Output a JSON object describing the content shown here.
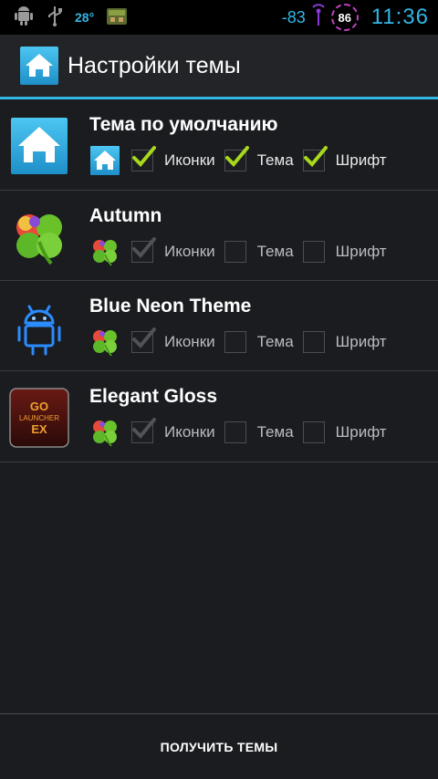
{
  "status_bar": {
    "temperature": "28°",
    "signal": "-83",
    "battery": "86",
    "time": "11:36",
    "icons": [
      "android-debug-icon",
      "usb-icon",
      "weather-icon",
      "app-notification-icon",
      "signal-icon"
    ]
  },
  "action_bar": {
    "title": "Настройки темы",
    "icon": "home-icon"
  },
  "themes": [
    {
      "name": "Тема по умолчанию",
      "icon": "default-home-icon",
      "options": [
        {
          "label": "Иконки",
          "checked": true,
          "enabled": true
        },
        {
          "label": "Тема",
          "checked": true,
          "enabled": true
        },
        {
          "label": "Шрифт",
          "checked": true,
          "enabled": true
        }
      ]
    },
    {
      "name": "Autumn",
      "icon": "clover-icon",
      "options": [
        {
          "label": "Иконки",
          "checked": true,
          "enabled": false
        },
        {
          "label": "Тема",
          "checked": false,
          "enabled": true
        },
        {
          "label": "Шрифт",
          "checked": false,
          "enabled": true
        }
      ]
    },
    {
      "name": "Blue Neon Theme",
      "icon": "neon-android-icon",
      "options": [
        {
          "label": "Иконки",
          "checked": true,
          "enabled": false
        },
        {
          "label": "Тема",
          "checked": false,
          "enabled": true
        },
        {
          "label": "Шрифт",
          "checked": false,
          "enabled": true
        }
      ]
    },
    {
      "name": "Elegant Gloss",
      "icon": "go-launcher-ex-icon",
      "icon_text": [
        "GO",
        "LAUNCHER",
        "EX"
      ],
      "options": [
        {
          "label": "Иконки",
          "checked": true,
          "enabled": false
        },
        {
          "label": "Тема",
          "checked": false,
          "enabled": true
        },
        {
          "label": "Шрифт",
          "checked": false,
          "enabled": true
        }
      ]
    }
  ],
  "bottom_button": "ПОЛУЧИТЬ ТЕМЫ",
  "colors": {
    "accent": "#33b5e5",
    "check_active": "#a8d81c",
    "check_disabled": "#4f5256",
    "background": "#1a1c1f"
  }
}
